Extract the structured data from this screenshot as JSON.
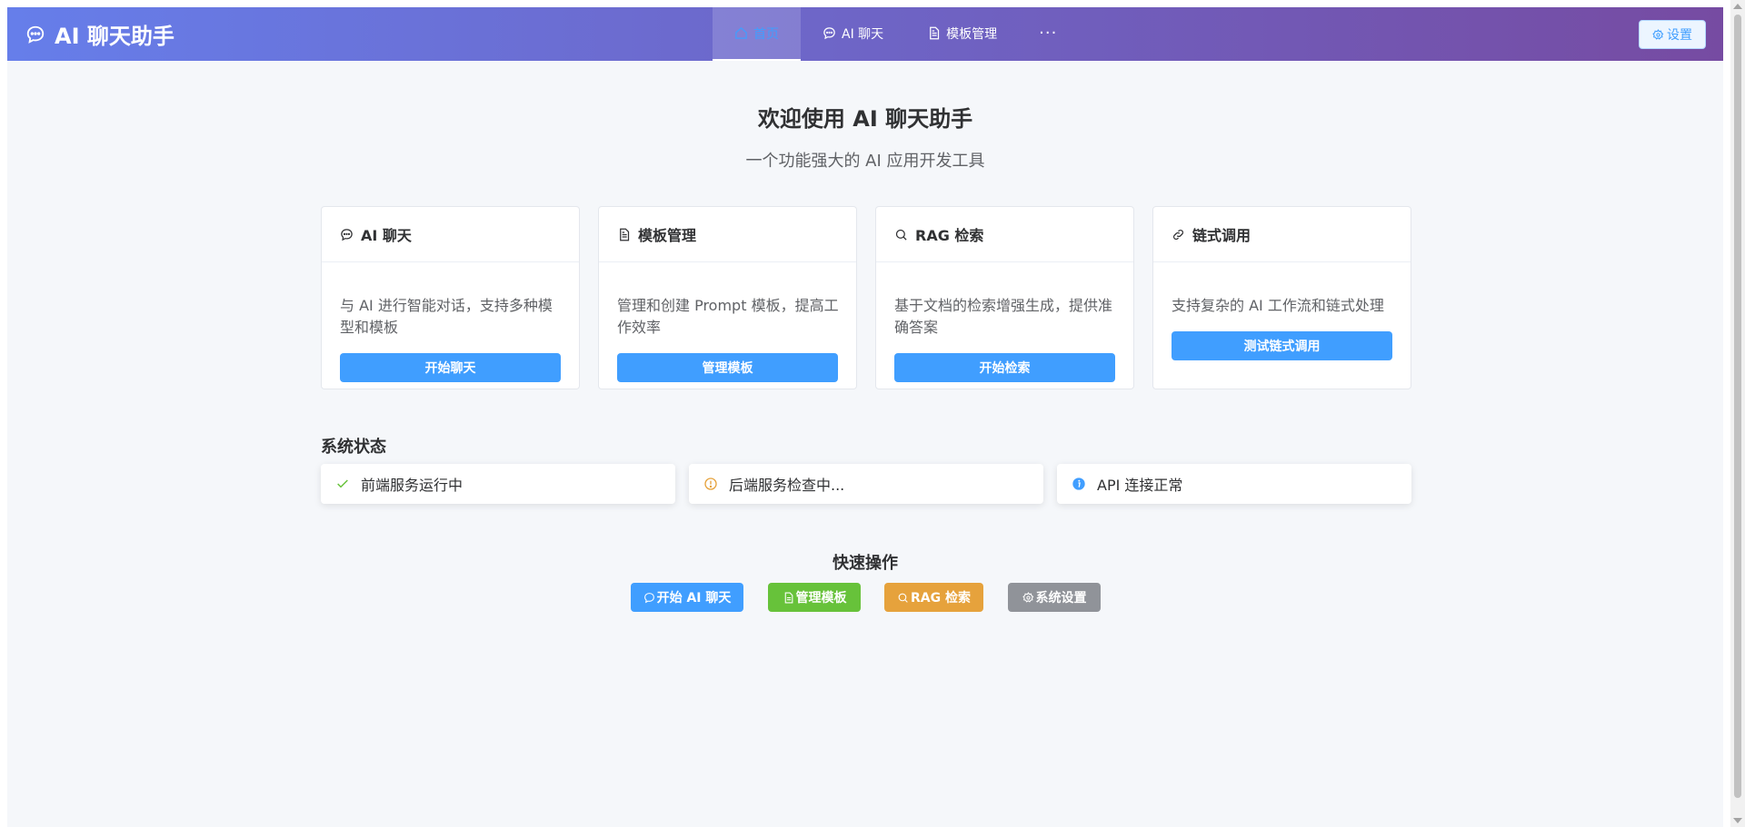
{
  "header": {
    "title": "AI 聊天助手",
    "nav": [
      {
        "label": "首页",
        "icon": "home-icon",
        "active": true
      },
      {
        "label": "AI 聊天",
        "icon": "chat-icon"
      },
      {
        "label": "模板管理",
        "icon": "document-icon"
      },
      {
        "label": "···",
        "icon": "more-icon"
      }
    ],
    "settings_label": "设置"
  },
  "welcome": {
    "title": "欢迎使用 AI 聊天助手",
    "subtitle": "一个功能强大的 AI 应用开发工具"
  },
  "features": [
    {
      "title": "AI 聊天",
      "icon": "chat-icon",
      "desc": "与 AI 进行智能对话，支持多种模型和模板",
      "button": "开始聊天"
    },
    {
      "title": "模板管理",
      "icon": "document-icon",
      "desc": "管理和创建 Prompt 模板，提高工作效率",
      "button": "管理模板"
    },
    {
      "title": "RAG 检索",
      "icon": "search-icon",
      "desc": "基于文档的检索增强生成，提供准确答案",
      "button": "开始检索"
    },
    {
      "title": "链式调用",
      "icon": "link-icon",
      "desc": "支持复杂的 AI 工作流和链式处理",
      "button": "测试链式调用"
    }
  ],
  "system_status": {
    "title": "系统状态",
    "items": [
      {
        "text": "前端服务运行中",
        "icon": "check-icon",
        "color": "#67c23a"
      },
      {
        "text": "后端服务检查中...",
        "icon": "warning-icon",
        "color": "#e6a23c"
      },
      {
        "text": "API 连接正常",
        "icon": "info-icon",
        "color": "#409eff"
      }
    ]
  },
  "quick_actions": {
    "title": "快速操作",
    "buttons": [
      {
        "label": "开始 AI 聊天",
        "icon": "chat-icon",
        "color": "#409eff"
      },
      {
        "label": "管理模板",
        "icon": "document-icon",
        "color": "#67c23a"
      },
      {
        "label": "RAG 检索",
        "icon": "search-icon",
        "color": "#e6a23c"
      },
      {
        "label": "系统设置",
        "icon": "gear-icon",
        "color": "#909399"
      }
    ]
  },
  "colors": {
    "header_gradient_start": "#667eea",
    "header_gradient_end": "#764ba2",
    "primary": "#409eff",
    "background": "#f5f7fa"
  }
}
